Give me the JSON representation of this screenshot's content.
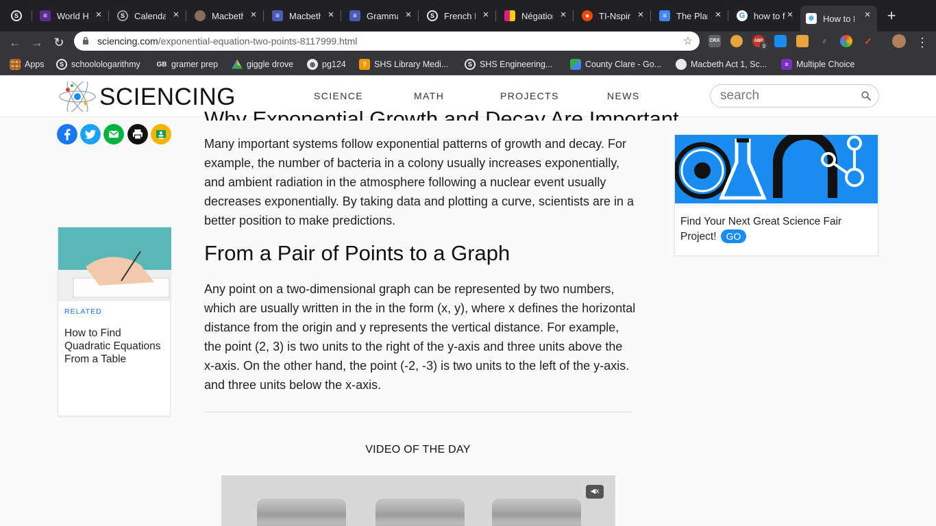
{
  "browser": {
    "tabs": [
      {
        "title": "",
        "icon": "schoology-icon",
        "color": "#202124"
      },
      {
        "title": "World Hi",
        "icon": "list-icon",
        "color": "#5c2d91"
      },
      {
        "title": "Calenda",
        "icon": "schoology-icon",
        "color": "#202124"
      },
      {
        "title": "Macbeth",
        "icon": "avatar-icon",
        "color": "#8a6d5a"
      },
      {
        "title": "Macbeth",
        "icon": "docs-icon",
        "color": "#4a5bb5"
      },
      {
        "title": "Gramma",
        "icon": "docs-icon",
        "color": "#4a5bb5"
      },
      {
        "title": "French I",
        "icon": "schoology-icon",
        "color": "#202124"
      },
      {
        "title": "Négation",
        "icon": "grid-icon",
        "color": "#e01b84"
      },
      {
        "title": "TI-Nspir",
        "icon": "reddit-icon",
        "color": "#ff4500"
      },
      {
        "title": "The Plan",
        "icon": "docs-icon",
        "color": "#4285f4"
      },
      {
        "title": "how to fi",
        "icon": "google-icon",
        "color": "#ffffff"
      },
      {
        "title": "How to F",
        "icon": "sciencing-icon",
        "color": "#ffffff"
      }
    ],
    "url_host": "sciencing.com",
    "url_path": "/exponential-equation-two-points-8117999.html",
    "bookmarks": [
      {
        "label": "Apps",
        "icon": "apps-grid-icon",
        "color": "#4285f4"
      },
      {
        "label": "schoolologarithmy",
        "icon": "schoology-icon",
        "color": "#202124"
      },
      {
        "label": "gramer prep",
        "icon": "gb-icon",
        "color": "#202124"
      },
      {
        "label": "giggle drove",
        "icon": "drive-icon",
        "color": "#0f9d58"
      },
      {
        "label": "pg124",
        "icon": "globe-icon",
        "color": "#5f6368"
      },
      {
        "label": "SHS Library Medi...",
        "icon": "library-icon",
        "color": "#f29900"
      },
      {
        "label": "SHS Engineering...",
        "icon": "schoology-icon",
        "color": "#202124"
      },
      {
        "label": "County Clare - Go...",
        "icon": "maps-icon",
        "color": "#34a853"
      },
      {
        "label": "Macbeth Act 1, Sc...",
        "icon": "avatar-icon",
        "color": "#b0805a"
      },
      {
        "label": "Multiple Choice",
        "icon": "list-icon",
        "color": "#7b2fbe"
      }
    ],
    "ext_labels": {
      "crx": "CRX",
      "abp": "ABP",
      "badge": "9"
    }
  },
  "site": {
    "logo": "SCIENCING",
    "nav": [
      "SCIENCE",
      "MATH",
      "PROJECTS",
      "NEWS"
    ],
    "search_placeholder": "search",
    "colors": {
      "accent": "#1a8cf0",
      "facebook": "#1877f2",
      "twitter": "#1da1f2",
      "email": "#00b341",
      "print": "#111111",
      "classroom": "#f4b400"
    }
  },
  "article": {
    "cut_heading": "Why Exponential Growth and Decay Are Important",
    "para1": "Many important systems follow exponential patterns of growth and decay. For example, the number of bacteria in a colony usually increases exponentially, and ambient radiation in the atmosphere following a nuclear event usually decreases exponentially. By taking data and plotting a curve, scientists are in a better position to make predictions.",
    "heading2": "From a Pair of Points to a Graph",
    "para2": "Any point on a two-dimensional graph can be represented by two numbers, which are usually written in the in the form (x, y), where x defines the horizontal distance from the origin and y represents the vertical distance. For example, the point (2, 3) is two units to the right of the y-axis and three units above the x-axis. On the other hand, the point (-2, -3) is two units to the left of the y-axis. and three units below the x-axis.",
    "video_label": "VIDEO OF THE DAY",
    "mute_label": "◀x"
  },
  "related": {
    "label": "RELATED",
    "title": "How to Find Quadratic Equations From a Table"
  },
  "ad": {
    "text": "Find Your Next Great Science Fair Project!",
    "go": "GO"
  }
}
